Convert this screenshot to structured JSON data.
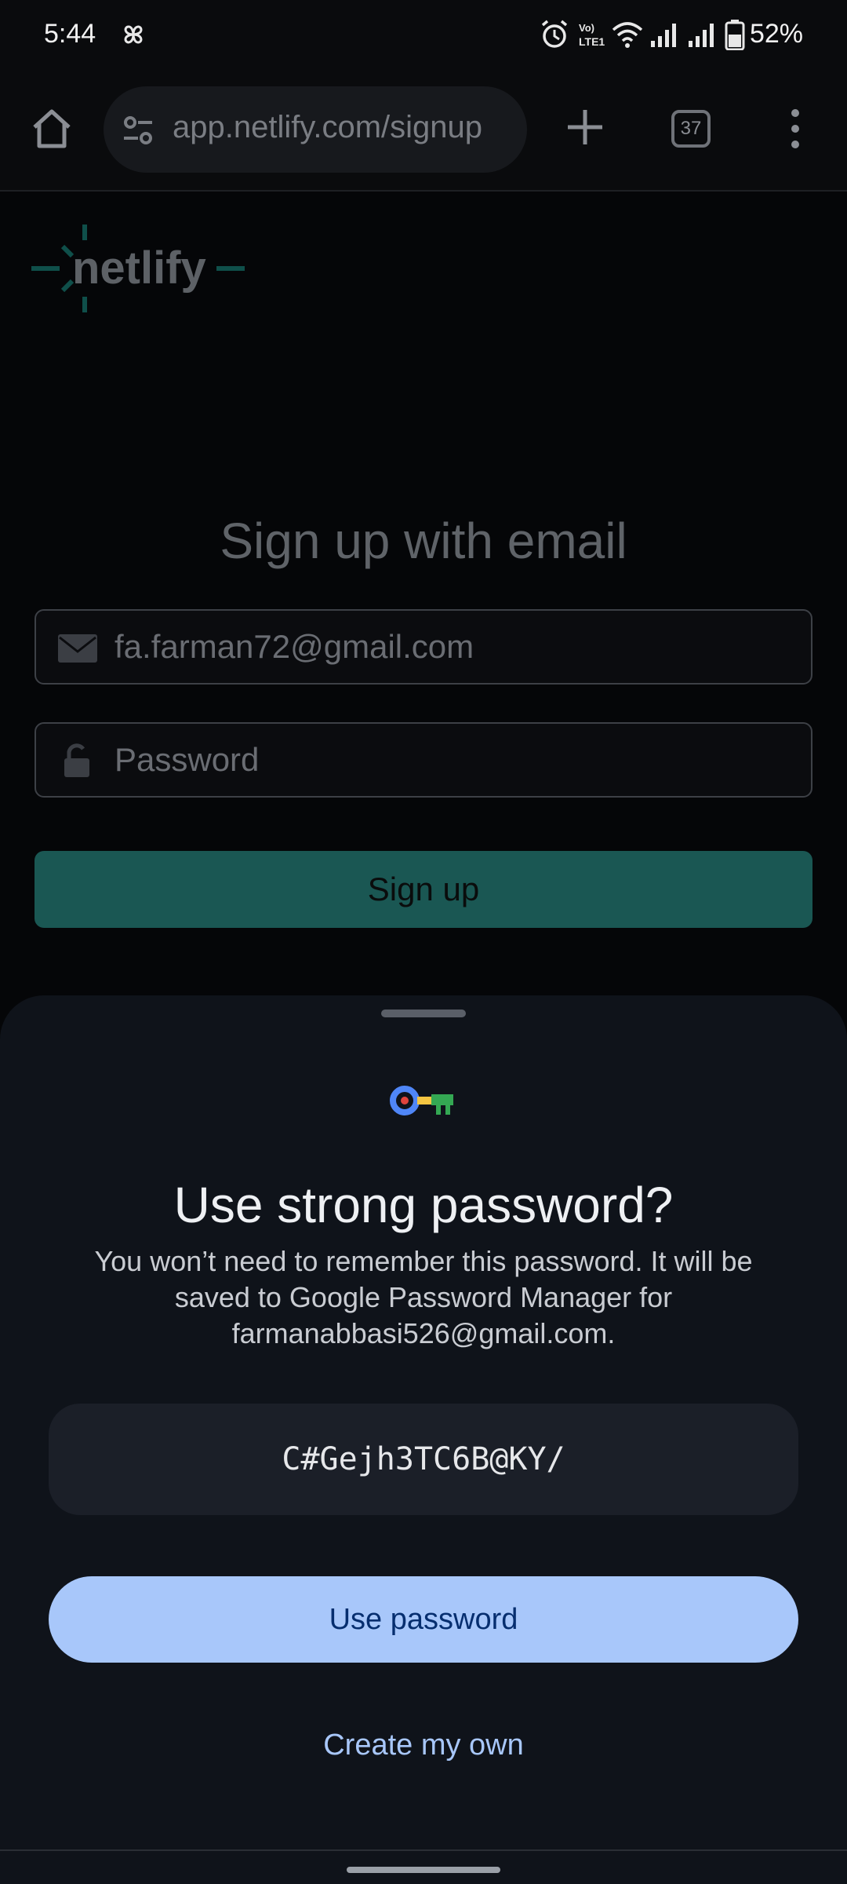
{
  "status_bar": {
    "time": "5:44",
    "battery": "52%",
    "icons": [
      "pinwheel-icon",
      "alarm-icon",
      "volte-icon",
      "wifi-icon",
      "signal-icon",
      "signal-icon",
      "battery-icon"
    ]
  },
  "browser": {
    "url": "app.netlify.com/signup",
    "tab_count": "37"
  },
  "page": {
    "logo_text": "netlify",
    "heading": "Sign up with email",
    "email_value": "fa.farman72@gmail.com",
    "password_placeholder": "Password",
    "signup_label": "Sign up",
    "accent_color": "#1a5753"
  },
  "sheet": {
    "title": "Use strong password?",
    "description": "You won’t need to remember this password. It will be saved to Google Password Manager for farmanabbasi526@gmail.com.",
    "generated_password": "C#Gejh3TC6B@KY/",
    "use_password_label": "Use password",
    "create_own_label": "Create my own",
    "primary_color": "#a8c7fa"
  }
}
